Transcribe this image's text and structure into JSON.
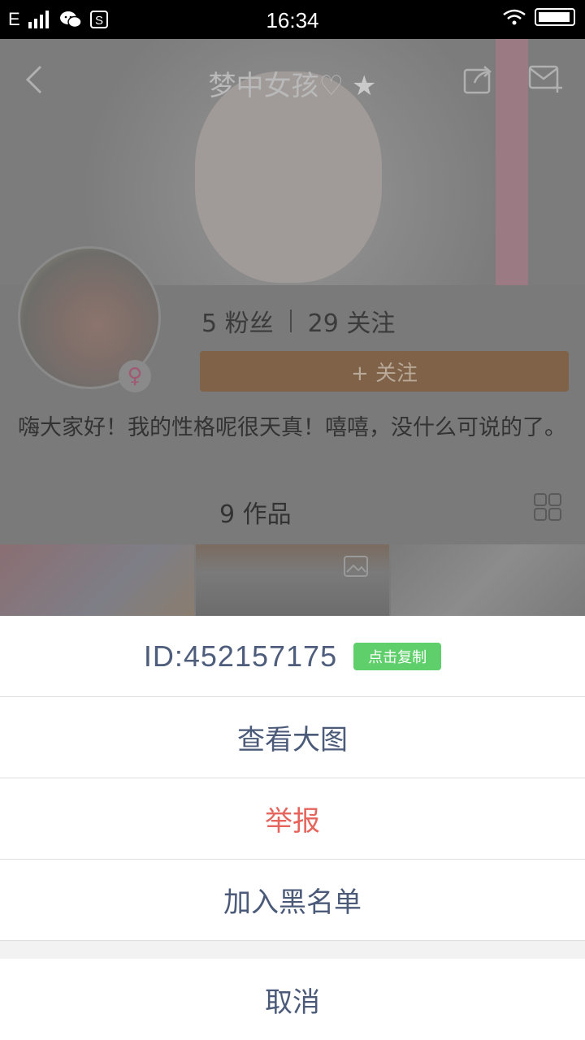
{
  "statusbar": {
    "network": "E",
    "time": "16:34"
  },
  "profile": {
    "title": "梦中女孩♡",
    "fans": "5 粉丝",
    "following": "29 关注",
    "follow_button": "+ 关注",
    "bio": "嗨大家好！我的性格呢很天真！嘻嘻，没什么可说的了。",
    "works": "9 作品"
  },
  "sheet": {
    "id_text": "ID:452157175",
    "copy_label": "点击复制",
    "view_large": "查看大图",
    "report": "举报",
    "blacklist": "加入黑名单",
    "cancel": "取消"
  },
  "colors": {
    "copy_badge": "#5ecf6a",
    "report_text": "#e5645b",
    "sheet_text": "#4a5a78"
  }
}
